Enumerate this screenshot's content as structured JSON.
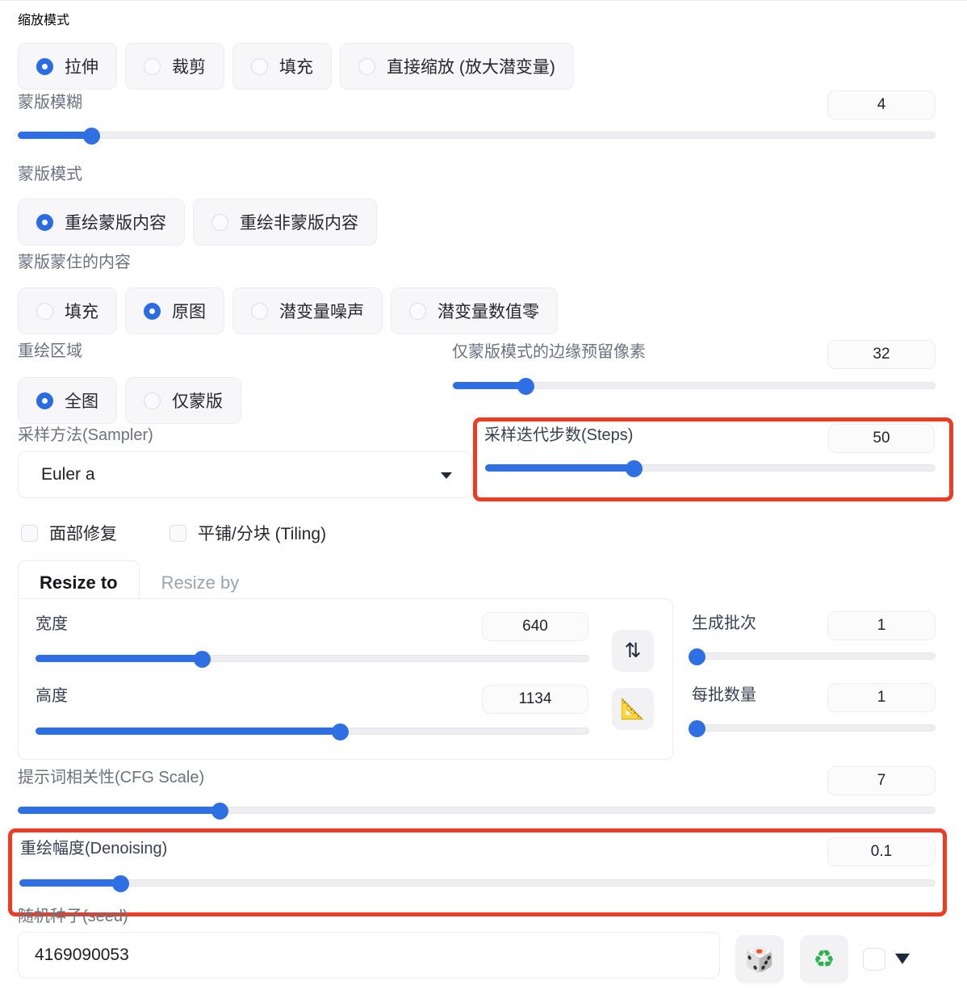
{
  "resize_mode": {
    "label": "缩放模式",
    "options": [
      {
        "label": "拉伸",
        "selected": true
      },
      {
        "label": "裁剪",
        "selected": false
      },
      {
        "label": "填充",
        "selected": false
      },
      {
        "label": "直接缩放 (放大潜变量)",
        "selected": false
      }
    ]
  },
  "mask_blur": {
    "label": "蒙版模糊",
    "value": "4",
    "percent": 8
  },
  "mask_mode": {
    "label": "蒙版模式",
    "options": [
      {
        "label": "重绘蒙版内容",
        "selected": true
      },
      {
        "label": "重绘非蒙版内容",
        "selected": false
      }
    ]
  },
  "masked_content": {
    "label": "蒙版蒙住的内容",
    "options": [
      {
        "label": "填充",
        "selected": false
      },
      {
        "label": "原图",
        "selected": true
      },
      {
        "label": "潜变量噪声",
        "selected": false
      },
      {
        "label": "潜变量数值零",
        "selected": false
      }
    ]
  },
  "inpaint_area": {
    "label": "重绘区域",
    "options": [
      {
        "label": "全图",
        "selected": true
      },
      {
        "label": "仅蒙版",
        "selected": false
      }
    ]
  },
  "inpaint_padding": {
    "label": "仅蒙版模式的边缘预留像素",
    "value": "32",
    "percent": 15
  },
  "sampler": {
    "label": "采样方法(Sampler)",
    "value": "Euler a"
  },
  "steps": {
    "label": "采样迭代步数(Steps)",
    "value": "50",
    "percent": 33,
    "highlighted": true
  },
  "checkboxes": [
    {
      "label": "面部修复",
      "checked": false
    },
    {
      "label": "平铺/分块 (Tiling)",
      "checked": false
    }
  ],
  "resize_tabs": [
    {
      "label": "Resize to",
      "active": true
    },
    {
      "label": "Resize by",
      "active": false
    }
  ],
  "width": {
    "label": "宽度",
    "value": "640",
    "percent": 30
  },
  "height": {
    "label": "高度",
    "value": "1134",
    "percent": 55
  },
  "swap_button": {
    "icon": "swap-vertical-icon",
    "glyph": "⇅"
  },
  "ratio_button": {
    "icon": "triangle-ruler-icon",
    "glyph": "📐"
  },
  "batch_count": {
    "label": "生成批次",
    "value": "1",
    "percent": 1
  },
  "batch_size": {
    "label": "每批数量",
    "value": "1",
    "percent": 1
  },
  "cfg_scale": {
    "label": "提示词相关性(CFG Scale)",
    "value": "7",
    "percent": 22
  },
  "denoising": {
    "label": "重绘幅度(Denoising)",
    "value": "0.1",
    "percent": 11,
    "highlighted": true
  },
  "seed": {
    "label": "随机种子(seed)",
    "value": "4169090053",
    "dice_button": {
      "icon": "dice-icon",
      "glyph": "🎲"
    },
    "recycle_button": {
      "icon": "recycle-icon",
      "glyph": "♻"
    },
    "extra_checkbox": {
      "icon": "checkbox-icon",
      "checked": false
    },
    "expand_caret": {
      "icon": "chevron-down-icon"
    }
  },
  "colors": {
    "accent": "#2f6fe4",
    "highlight": "#ef3b21",
    "label": "#6b7280",
    "text": "#27272e"
  }
}
